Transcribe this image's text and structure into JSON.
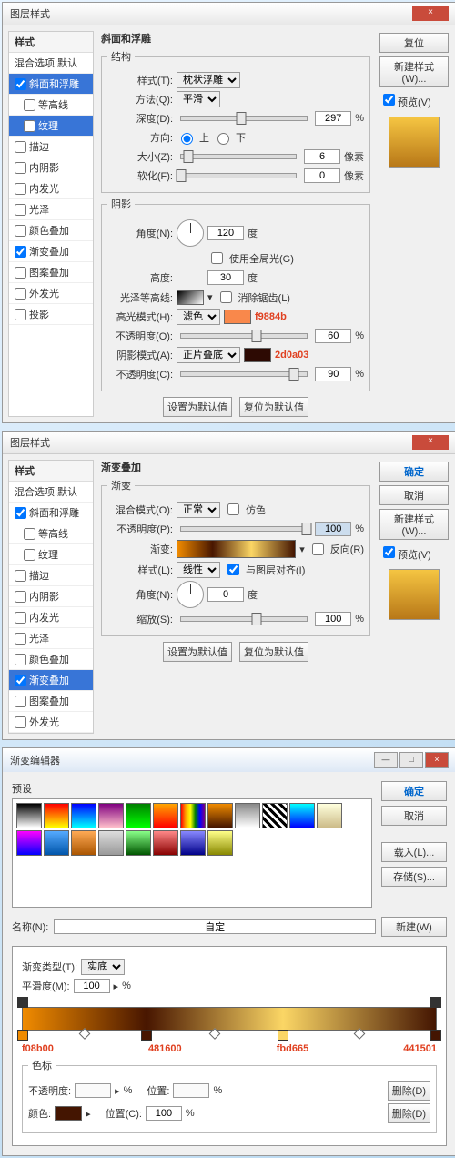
{
  "d1": {
    "title": "图层样式",
    "styles_hdr": "样式",
    "blend": "混合选项:默认",
    "effects": [
      {
        "n": "斜面和浮雕",
        "c": true,
        "s": true
      },
      {
        "n": "等高线",
        "c": false,
        "i": true
      },
      {
        "n": "纹理",
        "c": false,
        "i": true,
        "s2": true
      },
      {
        "n": "描边",
        "c": false
      },
      {
        "n": "内阴影",
        "c": false
      },
      {
        "n": "内发光",
        "c": false
      },
      {
        "n": "光泽",
        "c": false
      },
      {
        "n": "颜色叠加",
        "c": false
      },
      {
        "n": "渐变叠加",
        "c": true
      },
      {
        "n": "图案叠加",
        "c": false
      },
      {
        "n": "外发光",
        "c": false
      },
      {
        "n": "投影",
        "c": false
      }
    ],
    "btns": {
      "reset": "复位",
      "newstyle": "新建样式(W)...",
      "preview": "预览(V)"
    },
    "struct": {
      "hdr": "结构",
      "title": "斜面和浮雕",
      "style_l": "样式(T):",
      "style_v": "枕状浮雕",
      "tech_l": "方法(Q):",
      "tech_v": "平滑",
      "depth_l": "深度(D):",
      "depth_v": "297",
      "pct": "%",
      "dir_l": "方向:",
      "up": "上",
      "down": "下",
      "size_l": "大小(Z):",
      "size_v": "6",
      "px": "像素",
      "soft_l": "软化(F):",
      "soft_v": "0"
    },
    "shade": {
      "hdr": "阴影",
      "angle_l": "角度(N):",
      "angle_v": "120",
      "deg": "度",
      "global": "使用全局光(G)",
      "alt_l": "高度:",
      "alt_v": "30",
      "gloss_l": "光泽等高线:",
      "aa": "消除锯齿(L)",
      "hi_l": "高光模式(H):",
      "hi_v": "滤色",
      "hi_op_l": "不透明度(O):",
      "hi_op_v": "60",
      "sh_l": "阴影模式(A):",
      "sh_v": "正片叠底",
      "sh_op_l": "不透明度(C):",
      "sh_op_v": "90"
    },
    "ann1": "f9884b",
    "ann2": "2d0a03",
    "def1": "设置为默认值",
    "def2": "复位为默认值"
  },
  "d2": {
    "title": "图层样式",
    "styles_hdr": "样式",
    "blend": "混合选项:默认",
    "effects": [
      {
        "n": "斜面和浮雕",
        "c": true
      },
      {
        "n": "等高线",
        "c": false,
        "i": true
      },
      {
        "n": "纹理",
        "c": false,
        "i": true
      },
      {
        "n": "描边",
        "c": false
      },
      {
        "n": "内阴影",
        "c": false
      },
      {
        "n": "内发光",
        "c": false
      },
      {
        "n": "光泽",
        "c": false
      },
      {
        "n": "颜色叠加",
        "c": false
      },
      {
        "n": "渐变叠加",
        "c": true,
        "s": true
      },
      {
        "n": "图案叠加",
        "c": false
      },
      {
        "n": "外发光",
        "c": false
      }
    ],
    "btns": {
      "ok": "确定",
      "cancel": "取消",
      "newstyle": "新建样式(W)...",
      "preview": "预览(V)"
    },
    "go": {
      "hdr": "渐变叠加",
      "sub": "渐变",
      "blend_l": "混合模式(O):",
      "blend_v": "正常",
      "dith": "仿色",
      "op_l": "不透明度(P):",
      "op_v": "100",
      "pct": "%",
      "grad_l": "渐变:",
      "rev": "反向(R)",
      "style_l": "样式(L):",
      "style_v": "线性",
      "align": "与图层对齐(I)",
      "angle_l": "角度(N):",
      "angle_v": "0",
      "deg": "度",
      "scale_l": "缩放(S):",
      "scale_v": "100"
    },
    "def1": "设置为默认值",
    "def2": "复位为默认值"
  },
  "ge": {
    "title": "渐变编辑器",
    "presets": "预设",
    "btns": {
      "ok": "确定",
      "cancel": "取消",
      "load": "载入(L)...",
      "save": "存储(S)...",
      "new": "新建(W)"
    },
    "name_l": "名称(N):",
    "name_v": "自定",
    "type_l": "渐变类型(T):",
    "type_v": "实底",
    "smooth_l": "平滑度(M):",
    "smooth_v": "100",
    "pct": "%",
    "stops": [
      {
        "p": 0,
        "c": "#f08b00"
      },
      {
        "p": 30,
        "c": "#481600"
      },
      {
        "p": 63,
        "c": "#fbd665"
      },
      {
        "p": 100,
        "c": "#441501"
      }
    ],
    "ann": [
      "f08b00",
      "481600",
      "fbd665",
      "441501"
    ],
    "cs": "色标",
    "op_l": "不透明度:",
    "pos_l": "位置:",
    "del": "删除(D)",
    "color_l": "颜色:",
    "pos2_l": "位置(C):",
    "pos2_v": "100"
  }
}
